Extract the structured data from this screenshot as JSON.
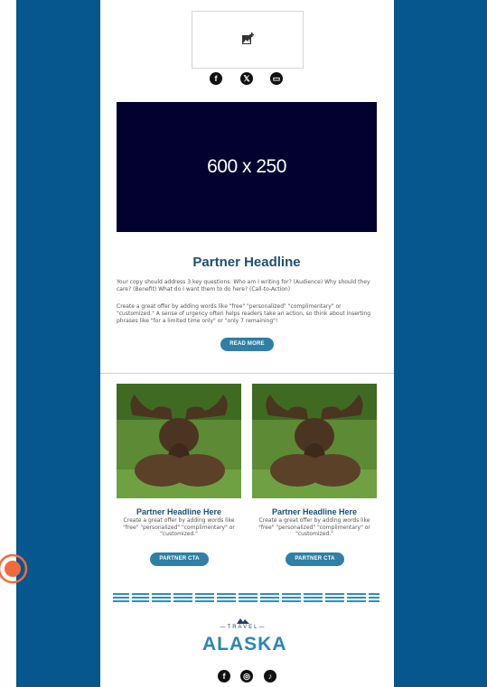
{
  "header": {
    "social_icons": [
      "facebook-icon",
      "x-twitter-icon",
      "chat-icon"
    ],
    "social_glyphs": [
      "f",
      "𝕏",
      "▭"
    ]
  },
  "banner": {
    "label": "600 x 250"
  },
  "main_article": {
    "headline": "Partner Headline",
    "paragraph_1": "Your copy should address 3 key questions: Who am I writing for? (Audience) Why should they care? (Benefit) What do I want them to do here? (Call-to-Action)",
    "paragraph_2": "Create a great offer by adding words like \"free\" \"personalized\" \"complimentary\" or \"customized.\" A sense of urgency often helps readers take an action, so think about inserting phrases like \"for a limited time only\" or \"only 7 remaining\"!",
    "cta_label": "READ MORE"
  },
  "cards": [
    {
      "headline": "Partner Headline Here",
      "copy": "Create a great offer by adding words like \"free\" \"personalized\" \"complimentary\" or \"customized.\"",
      "cta_label": "PARTNER CTA"
    },
    {
      "headline": "Partner Headline Here",
      "copy": "Create a great offer by adding words like \"free\" \"personalized\" \"complimentary\" or \"customized.\"",
      "cta_label": "PARTNER CTA"
    }
  ],
  "footer": {
    "brand_top": "TRAVEL",
    "brand_main": "ALASKA",
    "social_icons": [
      "facebook-icon",
      "instagram-icon",
      "tiktok-icon"
    ],
    "social_glyphs": [
      "f",
      "◎",
      "♪"
    ]
  },
  "colors": {
    "side_panel": "#07578f",
    "banner_bg": "#02012f",
    "headline": "#1d4f74",
    "cta": "#2f7fa6",
    "cursor": "#f26a3a"
  }
}
